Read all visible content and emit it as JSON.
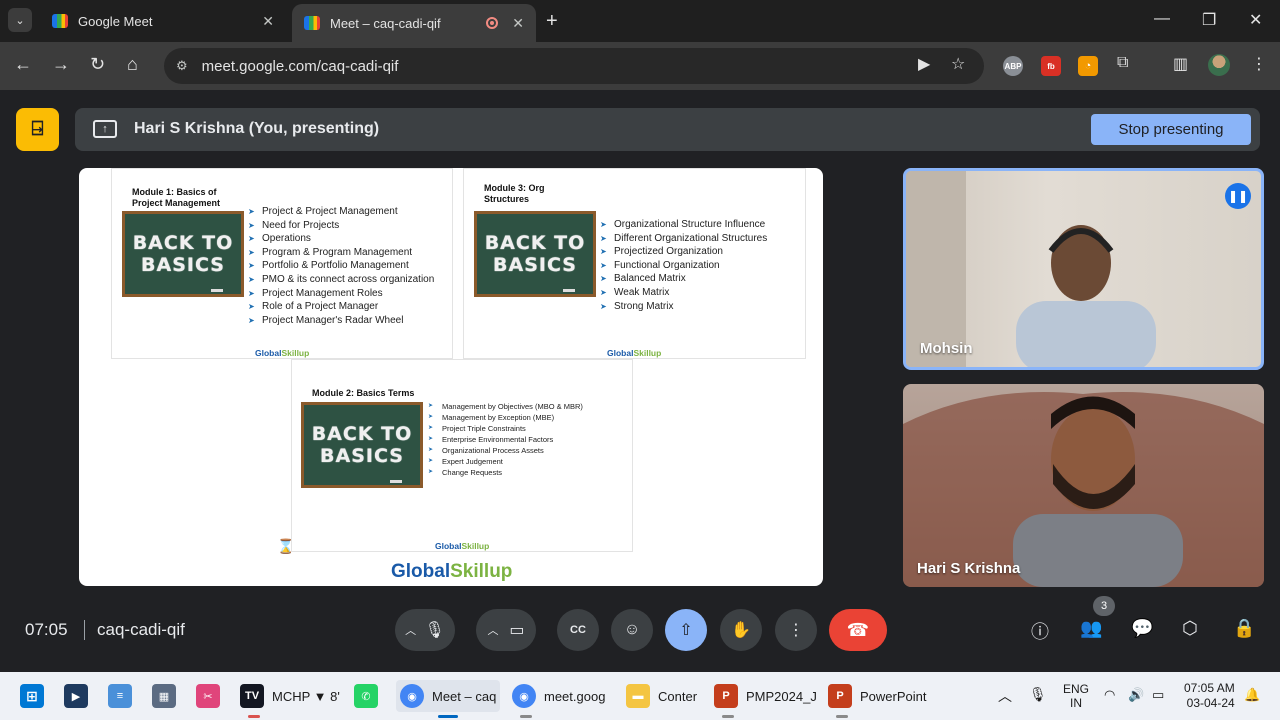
{
  "browser": {
    "tabs": [
      {
        "title": "Google Meet",
        "favicon": "meet-favicon"
      },
      {
        "title": "Meet – caq-cadi-qif",
        "favicon": "meet-favicon",
        "recording": true
      }
    ],
    "url": "meet.google.com/caq-cadi-qif",
    "extensions": [
      "ABP",
      "fb",
      "rss",
      "extensions-puzzle"
    ]
  },
  "meet": {
    "presenting_label": "Hari S Krishna (You, presenting)",
    "stop_presenting_label": "Stop presenting",
    "time": "07:05",
    "meeting_code": "caq-cadi-qif",
    "participant_count": "3",
    "participants": [
      {
        "name": "Mohsin",
        "speaking": true
      },
      {
        "name": "Hari S Krishna",
        "speaking": false
      }
    ]
  },
  "slide": {
    "module1": {
      "title": "Module 1: Basics of Project Management",
      "items": [
        "Project & Project Management",
        "Need for Projects",
        "Operations",
        "Program & Program Management",
        "Portfolio & Portfolio Management",
        "PMO & its connect across organization",
        "Project Management Roles",
        "Role of a Project Manager",
        "Project Manager's Radar Wheel"
      ]
    },
    "module2": {
      "title": "Module 2: Basics Terms",
      "items": [
        "Management by Objectives (MBO & MBR)",
        "Management by Exception (MBE)",
        "Project Triple Constraints",
        "Enterprise Environmental Factors",
        "Organizational Process Assets",
        "Expert Judgement",
        "Change Requests"
      ]
    },
    "module3": {
      "title": "Module 3: Org Structures",
      "items": [
        "Organizational Structure Influence",
        "Different Organizational Structures",
        "Projectized Organization",
        "Functional Organization",
        "Balanced Matrix",
        "Weak Matrix",
        "Strong Matrix"
      ]
    },
    "chalkboard_text": [
      "BACK TO",
      "BASICS"
    ],
    "logo": {
      "part1": "Global",
      "part2": "Skillup"
    }
  },
  "taskbar": {
    "apps": [
      {
        "label": "MCHP ▼ 8'"
      },
      {
        "label": "Meet – caq"
      },
      {
        "label": "meet.goog"
      },
      {
        "label": "Conter"
      },
      {
        "label": "PMP2024_J"
      },
      {
        "label": "PowerPoint"
      }
    ],
    "lang_line1": "ENG",
    "lang_line2": "IN",
    "clock_time": "07:05 AM",
    "clock_date": "03-04-24"
  }
}
